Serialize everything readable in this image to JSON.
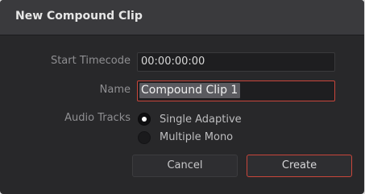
{
  "dialog": {
    "title": "New Compound Clip",
    "start_timecode": {
      "label": "Start Timecode",
      "value": "00:00:00:00"
    },
    "name": {
      "label": "Name",
      "value": "Compound Clip 1"
    },
    "audio_tracks": {
      "label": "Audio Tracks",
      "options": [
        {
          "label": "Single Adaptive",
          "selected": true
        },
        {
          "label": "Multiple Mono",
          "selected": false
        }
      ]
    },
    "buttons": {
      "cancel": "Cancel",
      "create": "Create"
    }
  },
  "colors": {
    "dialog_bg": "#28282a",
    "titlebar_bg": "#3a3a3d",
    "field_bg": "#1e1e20",
    "focus_accent": "#c9463b",
    "label_text": "#8f8f92",
    "selection_bg": "#5a5a5f"
  }
}
